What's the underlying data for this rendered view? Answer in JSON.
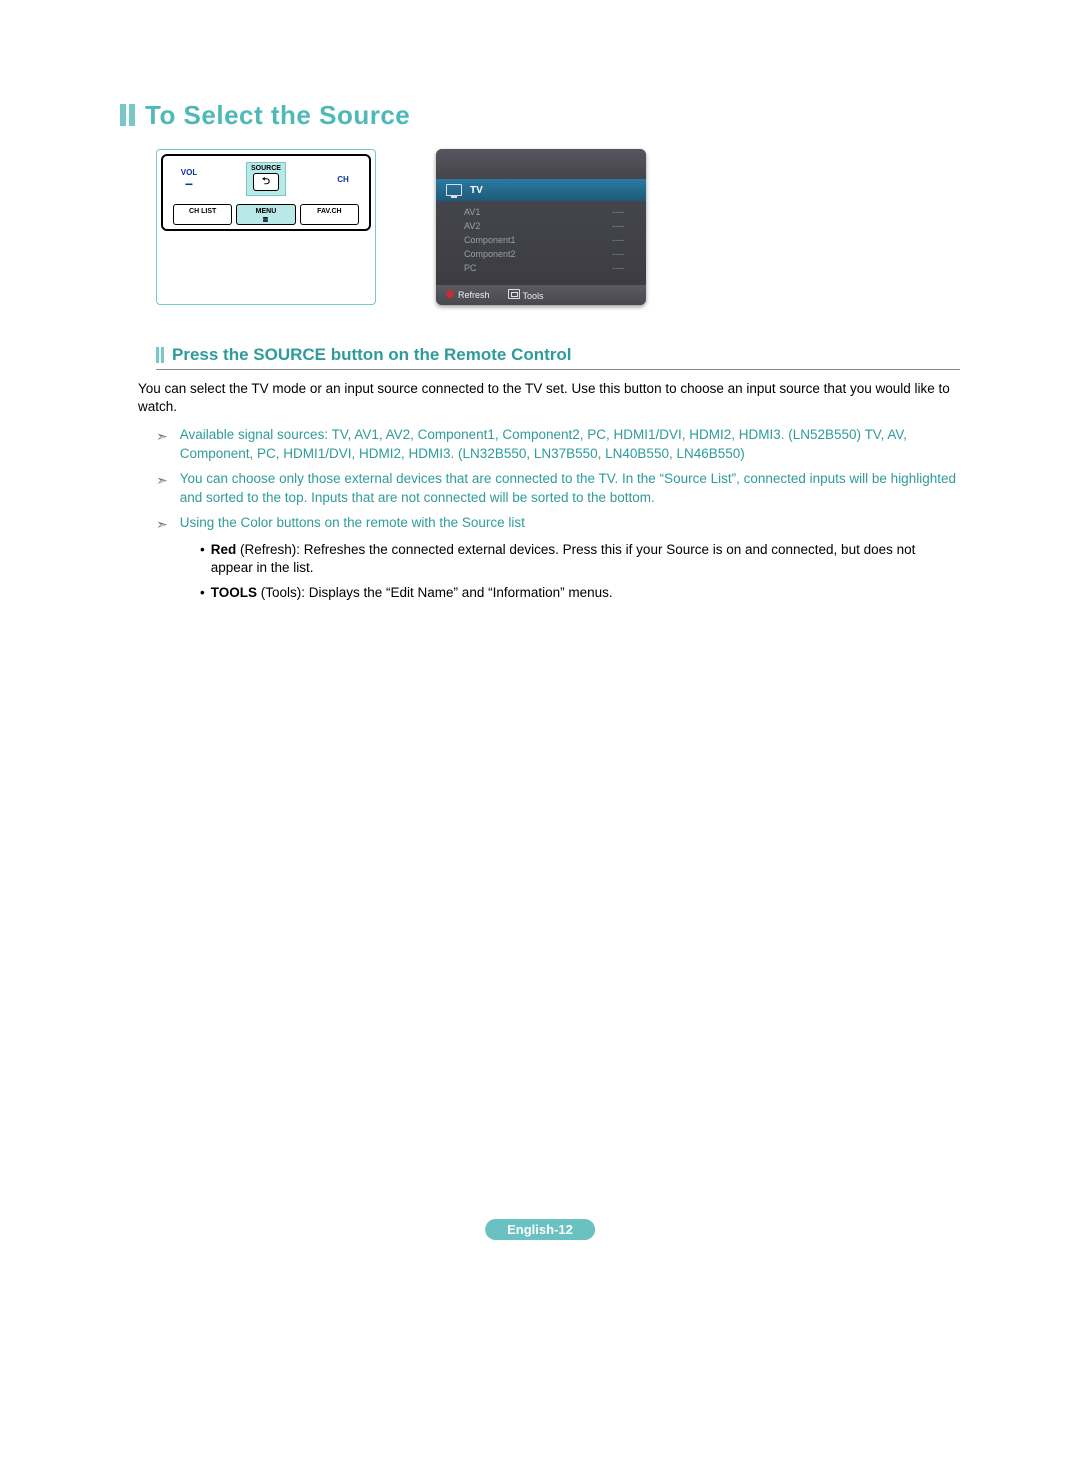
{
  "title": "To Select the Source",
  "remote": {
    "vol": "VOL",
    "ch": "CH",
    "source_label": "SOURCE",
    "source_glyph": "⮌",
    "chlist": "CH LIST",
    "menu": "MENU",
    "menu_sub": "▥",
    "favch": "FAV.CH",
    "minus": "−"
  },
  "osd": {
    "top_right": "",
    "selected": "TV",
    "items": [
      {
        "name": "AV1",
        "status": "----"
      },
      {
        "name": "AV2",
        "status": "----"
      },
      {
        "name": "Component1",
        "status": "----"
      },
      {
        "name": "Component2",
        "status": "----"
      },
      {
        "name": "PC",
        "status": "----"
      }
    ],
    "refresh": "Refresh",
    "tools": "Tools"
  },
  "subhead": "Press the SOURCE button on the Remote Control",
  "intro": "You can select the TV mode or an input source connected to the TV set. Use this button to choose an input source that you would like to watch.",
  "arrows": [
    "Available signal sources: TV, AV1, AV2, Component1, Component2, PC, HDMI1/DVI, HDMI2, HDMI3. (LN52B550) TV, AV, Component, PC, HDMI1/DVI, HDMI2, HDMI3. (LN32B550, LN37B550, LN40B550, LN46B550)",
    "You can choose only those external devices that are connected to the TV. In the “Source List”, connected inputs will be highlighted and sorted to the top. Inputs that are not connected will be sorted to the bottom.",
    "Using the Color buttons on the remote with the Source list"
  ],
  "bullets": {
    "red_prefix": "Red",
    "red_text": " (Refresh): Refreshes the connected external devices. Press this if your Source is on and connected, but does not appear in the list.",
    "tools_prefix": "TOOLS",
    "tools_text": " (Tools): Displays the “Edit Name” and “Information” menus."
  },
  "page_num": "English-12"
}
